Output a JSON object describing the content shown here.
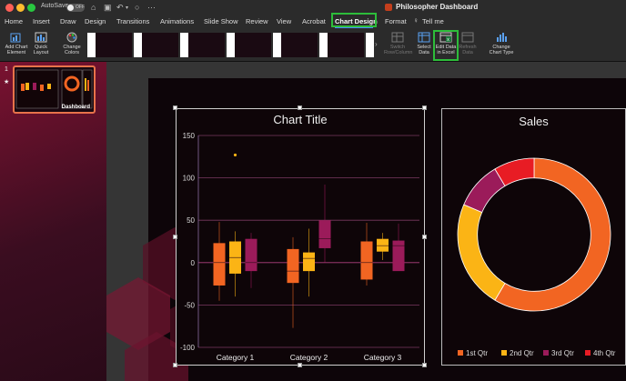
{
  "titlebar": {
    "autosave_label": "AutoSave",
    "autosave_state": "OFF",
    "doc_title": "Philosopher Dashboard"
  },
  "menu": {
    "items": [
      "Home",
      "Insert",
      "Draw",
      "Design",
      "Transitions",
      "Animations",
      "Slide Show",
      "Review",
      "View",
      "Acrobat",
      "Chart Design",
      "Format",
      "Tell me"
    ],
    "active": "Chart Design"
  },
  "ribbon": {
    "add_chart_element": "Add Chart Element",
    "quick_layout": "Quick Layout",
    "change_colors": "Change Colors",
    "switch_row_column": "Switch Row/Column",
    "select_data": "Select Data",
    "edit_data_in_excel": "Edit Data in Excel",
    "refresh_data": "Refresh Data",
    "change_chart_type": "Change Chart Type"
  },
  "slides_pane": {
    "slide_number": "1",
    "star": "★",
    "thumb_label": "Dashboard"
  },
  "colors": {
    "q1": "#f26522",
    "q2": "#fbb415",
    "q3": "#9b1b5a",
    "q4": "#e81c24",
    "accent_green": "#2dbd3a"
  },
  "chart_data": [
    {
      "type": "box",
      "title": "Chart Title",
      "categories": [
        "Category 1",
        "Category 2",
        "Category 3"
      ],
      "ylim": [
        -100,
        150
      ],
      "yticks": [
        "150",
        "100",
        "50",
        "0",
        "-50",
        "-100"
      ],
      "series": [
        {
          "color": "#f26522",
          "boxes": [
            {
              "min": -45,
              "q1": -27,
              "median": 0,
              "q3": 23,
              "max": 48
            },
            {
              "min": -77,
              "q1": -24,
              "median": -10,
              "q3": 16,
              "max": 30
            },
            {
              "min": -27,
              "q1": -20,
              "median": 0,
              "q3": 25,
              "max": 47
            }
          ]
        },
        {
          "color": "#fbb415",
          "boxes": [
            {
              "min": -40,
              "q1": -13,
              "median": 6,
              "q3": 25,
              "max": 37
            },
            {
              "min": -40,
              "q1": -10,
              "median": 5,
              "q3": 12,
              "max": 40
            },
            {
              "min": 3,
              "q1": 13,
              "median": 20,
              "q3": 28,
              "max": 35
            }
          ],
          "outliers": [
            [
              0,
              127
            ]
          ]
        },
        {
          "color": "#9b1b5a",
          "boxes": [
            {
              "min": -30,
              "q1": -10,
              "median": 0,
              "q3": 28,
              "max": 35
            },
            {
              "min": 0,
              "q1": 17,
              "median": 28,
              "q3": 50,
              "max": 92
            },
            {
              "min": -5,
              "q1": -10,
              "median": 20,
              "q3": 26,
              "max": 46
            }
          ]
        }
      ]
    },
    {
      "type": "pie",
      "title": "Sales",
      "categories": [
        "1st Qtr",
        "2nd Qtr",
        "3rd Qtr",
        "4th Qtr"
      ],
      "values": [
        8.2,
        3.2,
        1.4,
        1.2
      ]
    }
  ]
}
